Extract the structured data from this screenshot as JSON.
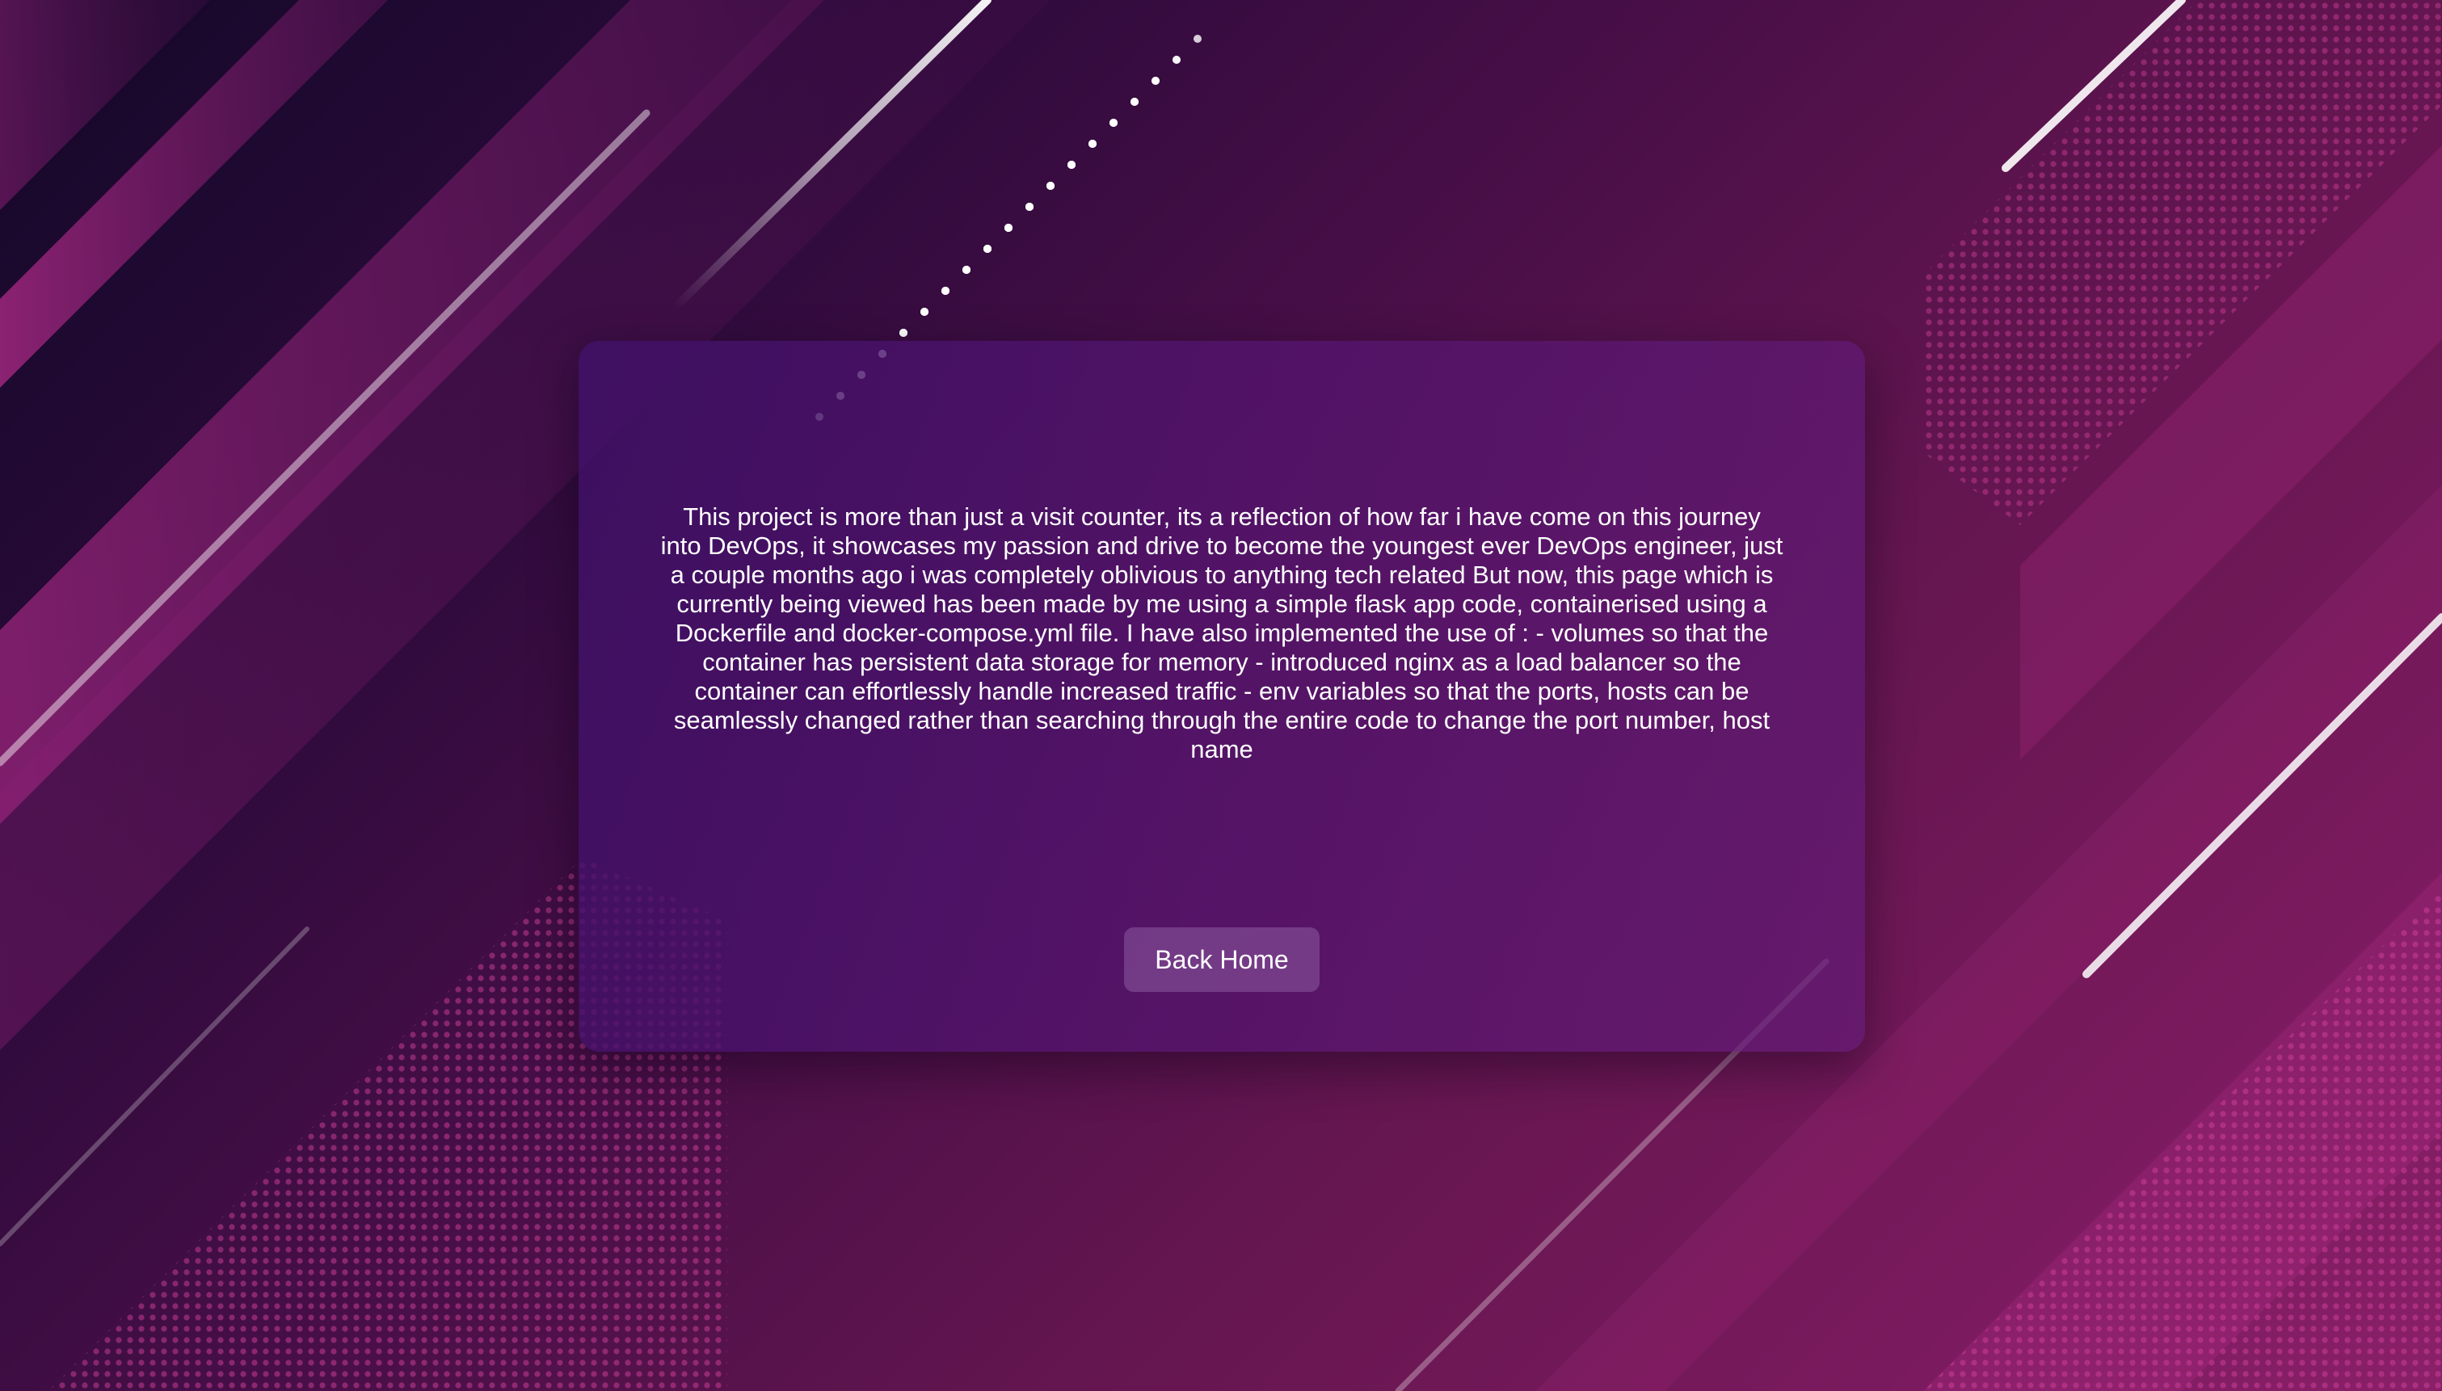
{
  "about": {
    "description": "This project is more than just a visit counter, its a reflection of how far i have come on this journey into DevOps, it showcases my passion and drive to become the youngest ever DevOps engineer, just a couple months ago i was completely oblivious to anything tech related But now, this page which is currently being viewed has been made by me using a simple flask app code, containerised using a Dockerfile and docker-compose.yml file. I have also implemented the use of : - volumes so that the container has persistent data storage for memory - introduced nginx as a load balancer so the container can effortlessly handle increased traffic - env variables so that the ports, hosts can be seamlessly changed rather than searching through the entire code to change the port number, host name",
    "back_button_label": "Back Home"
  },
  "theme": {
    "background_dark": "#140828",
    "background_mid": "#4a0f48",
    "background_light": "#8a2068",
    "accent_pink": "#c2308a",
    "card_color": "#4e1470",
    "text_color": "#ffffff"
  }
}
